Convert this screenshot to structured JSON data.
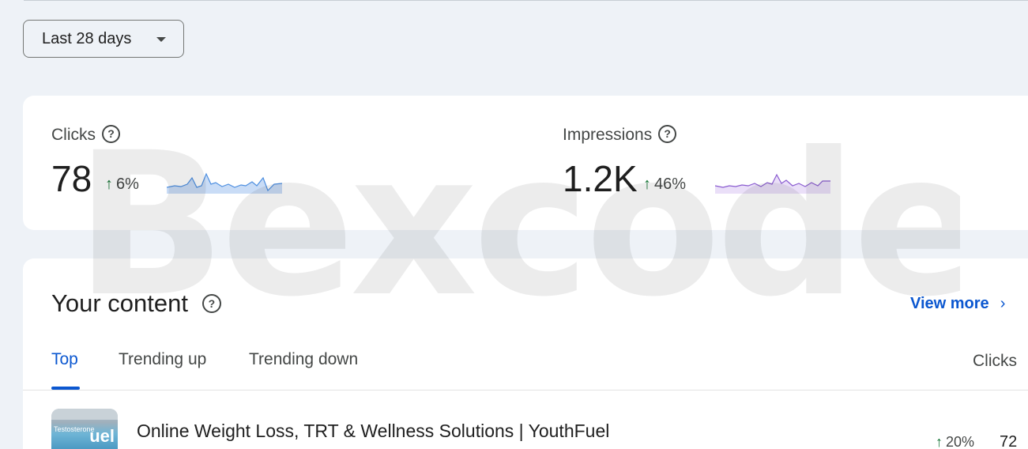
{
  "date_range": {
    "label": "Last 28 days",
    "icon": "caret-down-icon"
  },
  "metrics": [
    {
      "label": "Clicks",
      "value": "78",
      "delta": "6%",
      "trend": "up",
      "spark_color": "#4e8fe0",
      "spark_fill": "#c9dcf6"
    },
    {
      "label": "Impressions",
      "value": "1.2K",
      "delta": "46%",
      "trend": "up",
      "spark_color": "#8a5cd0",
      "spark_fill": "#eadff8"
    }
  ],
  "content": {
    "title": "Your content",
    "view_more": "View more",
    "tabs": [
      "Top",
      "Trending up",
      "Trending down"
    ],
    "active_tab": "Top",
    "column_header": "Clicks",
    "rows": [
      {
        "title": "Online Weight Loss, TRT & Wellness Solutions | YouthFuel",
        "thumb_text": "Testosterone",
        "thumb_brand": "uel",
        "delta": "20%",
        "trend": "up",
        "value": "72"
      }
    ]
  },
  "watermark": "Bexcode",
  "colors": {
    "accent": "#0b57d0",
    "positive": "#137333",
    "background": "#eef2f7"
  }
}
